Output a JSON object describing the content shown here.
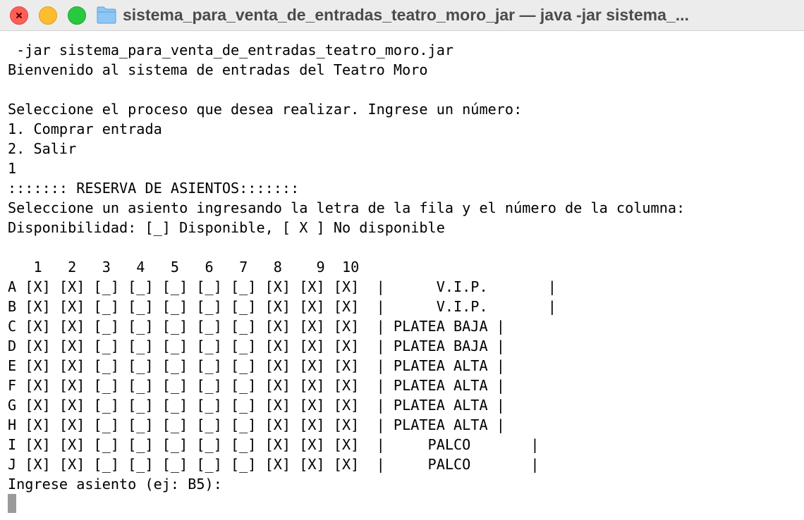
{
  "window": {
    "title": "sistema_para_venta_de_entradas_teatro_moro_jar — java -jar sistema_..."
  },
  "terminal": {
    "lines_top": [
      " -jar sistema_para_venta_de_entradas_teatro_moro.jar",
      "Bienvenido al sistema de entradas del Teatro Moro",
      "",
      "Seleccione el proceso que desea realizar. Ingrese un número:",
      "1. Comprar entrada",
      "2. Salir",
      "1",
      "::::::: RESERVA DE ASIENTOS:::::::",
      "Seleccione un asiento ingresando la letra de la fila y el número de la columna:",
      "Disponibilidad: [_] Disponible, [ X ] No disponible",
      ""
    ],
    "column_header": "   1   2   3   4   5   6   7   8    9  10",
    "seat_rows": [
      "A [X] [X] [_] [_] [_] [_] [_] [X] [X] [X]  |      V.I.P.       |",
      "B [X] [X] [_] [_] [_] [_] [_] [X] [X] [X]  |      V.I.P.       |",
      "C [X] [X] [_] [_] [_] [_] [_] [X] [X] [X]  | PLATEA BAJA |",
      "D [X] [X] [_] [_] [_] [_] [_] [X] [X] [X]  | PLATEA BAJA |",
      "E [X] [X] [_] [_] [_] [_] [_] [X] [X] [X]  | PLATEA ALTA |",
      "F [X] [X] [_] [_] [_] [_] [_] [X] [X] [X]  | PLATEA ALTA |",
      "G [X] [X] [_] [_] [_] [_] [_] [X] [X] [X]  | PLATEA ALTA |",
      "H [X] [X] [_] [_] [_] [_] [_] [X] [X] [X]  | PLATEA ALTA |",
      "I [X] [X] [_] [_] [_] [_] [_] [X] [X] [X]  |     PALCO       |",
      "J [X] [X] [_] [_] [_] [_] [_] [X] [X] [X]  |     PALCO       |"
    ],
    "prompt": "Ingrese asiento (ej: B5):"
  }
}
